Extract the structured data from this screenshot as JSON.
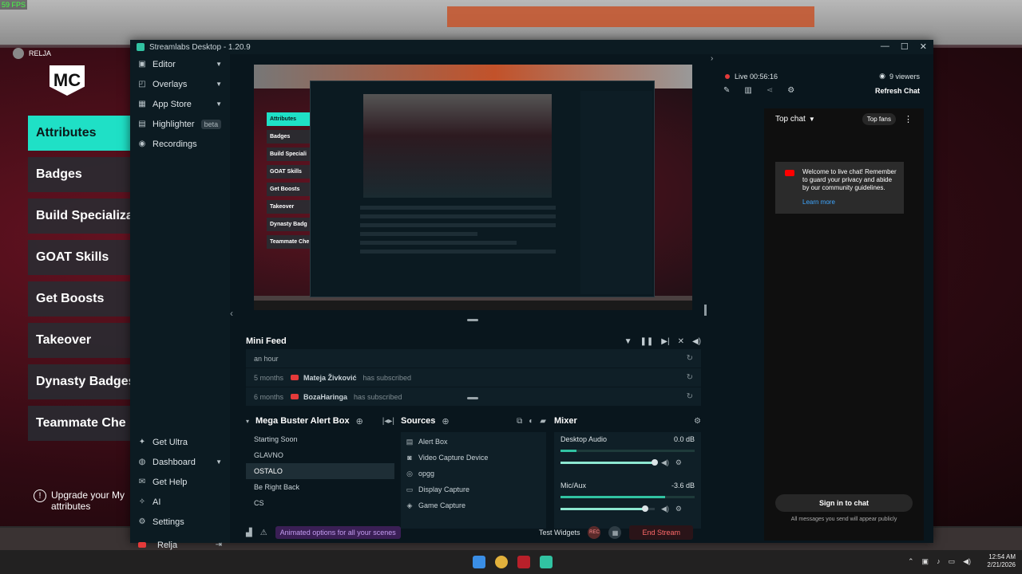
{
  "background": {
    "fps": "59 FPS",
    "player_tag": "RELJA",
    "logo": "MC",
    "menu": [
      "Attributes",
      "Badges",
      "Build Specializa",
      "GOAT Skills",
      "Get Boosts",
      "Takeover",
      "Dynasty Badges",
      "Teammate Che"
    ],
    "upgrade_note": "Upgrade your My attributes"
  },
  "window": {
    "title": "Streamlabs Desktop - 1.20.9",
    "controls": [
      "—",
      "☐",
      "✕"
    ]
  },
  "sidebar": {
    "items": [
      {
        "label": "Editor",
        "icon": "editor-icon"
      },
      {
        "label": "Overlays",
        "icon": "overlays-icon"
      },
      {
        "label": "App Store",
        "icon": "app-store-icon"
      },
      {
        "label": "Highlighter",
        "icon": "highlighter-icon",
        "badge": "beta"
      },
      {
        "label": "Recordings",
        "icon": "recordings-icon"
      }
    ],
    "bottom_items": [
      {
        "label": "Get Ultra",
        "icon": "ultra-icon"
      },
      {
        "label": "Dashboard",
        "icon": "dashboard-icon"
      },
      {
        "label": "Get Help",
        "icon": "help-icon"
      },
      {
        "label": "AI",
        "icon": "ai-icon"
      },
      {
        "label": "Settings",
        "icon": "gear-icon"
      },
      {
        "label": "Relja",
        "icon": "youtube-icon"
      }
    ]
  },
  "preview": {
    "side_items": [
      "Attributes",
      "Badges",
      "Build Speciali",
      "GOAT Skills",
      "Get Boosts",
      "Takeover",
      "Dynasty Badg",
      "Teammate Che"
    ]
  },
  "mini_feed": {
    "title": "Mini Feed",
    "rows": [
      {
        "ago": "an hour",
        "name": "",
        "action": ""
      },
      {
        "ago": "5 months",
        "name": "Mateja Živković",
        "action": "has subscribed"
      },
      {
        "ago": "6 months",
        "name": "BozaHaringa",
        "action": "has subscribed"
      }
    ]
  },
  "scenes": {
    "title": "Mega Buster Alert Box",
    "items": [
      "Starting Soon",
      "GLAVNO",
      "OSTALO",
      "Be Right Back",
      "CS"
    ],
    "selected": "OSTALO"
  },
  "sources": {
    "title": "Sources",
    "items": [
      {
        "label": "Alert Box",
        "icon": "alert-box-icon"
      },
      {
        "label": "Video Capture Device",
        "icon": "camera-icon"
      },
      {
        "label": "opgg",
        "icon": "globe-icon"
      },
      {
        "label": "Display Capture",
        "icon": "monitor-icon"
      },
      {
        "label": "Game Capture",
        "icon": "gamepad-icon"
      }
    ]
  },
  "mixer": {
    "title": "Mixer",
    "channels": [
      {
        "name": "Desktop Audio",
        "db": "0.0 dB",
        "level": 0.12,
        "volume": 1.0
      },
      {
        "name": "Mic/Aux",
        "db": "-3.6 dB",
        "level": 0.78,
        "volume": 0.9
      }
    ]
  },
  "footer": {
    "promo": "Animated options for all your scenes",
    "test_widgets": "Test Widgets",
    "rec": "REC",
    "end_stream": "End Stream"
  },
  "chat": {
    "live_time": "Live 00:56:16",
    "viewers": "9 viewers",
    "refresh": "Refresh Chat",
    "top_chat": "Top chat",
    "top_fans": "Top fans",
    "welcome": "Welcome to live chat! Remember to guard your privacy and abide by our community guidelines.",
    "learn_more": "Learn more",
    "sign_in": "Sign in to chat",
    "sign_in_note": "All messages you send will appear publicly"
  },
  "taskbar": {
    "time": "12:54 AM",
    "date": "2/21/2026"
  },
  "colors": {
    "accent": "#31c3a2",
    "live": "#e43a3a",
    "end_stream": "#ff6a6a"
  }
}
